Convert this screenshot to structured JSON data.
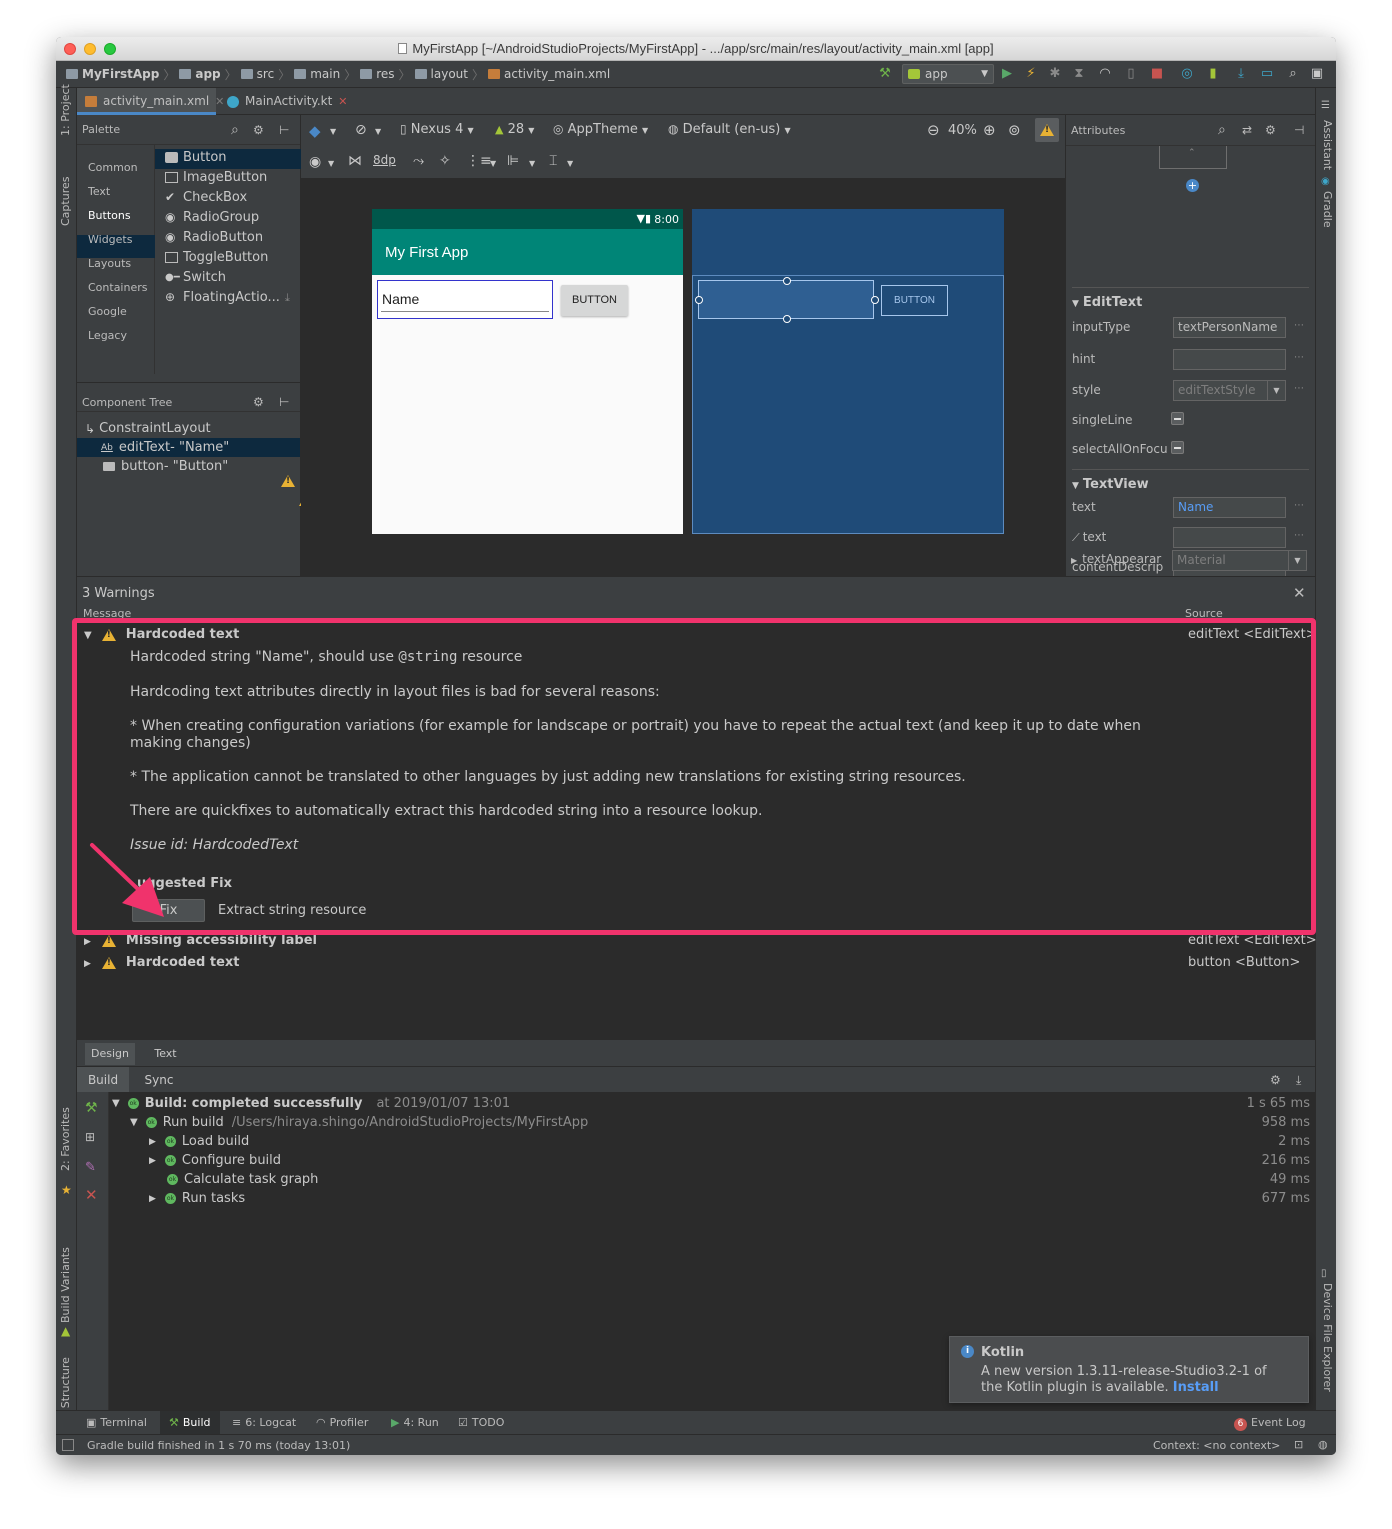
{
  "window": {
    "title": "MyFirstApp [~/AndroidStudioProjects/MyFirstApp] - .../app/src/main/res/layout/activity_main.xml [app]"
  },
  "breadcrumb": [
    "MyFirstApp",
    "app",
    "src",
    "main",
    "res",
    "layout",
    "activity_main.xml"
  ],
  "run_config": "app",
  "editor_tabs": [
    "activity_main.xml",
    "MainActivity.kt"
  ],
  "side_tools": {
    "left": [
      "1: Project",
      "Captures",
      "2: Favorites",
      "Build Variants",
      "Z: Structure"
    ],
    "right": [
      "Assistant",
      "Gradle",
      "Device File Explorer"
    ]
  },
  "palette": {
    "title": "Palette",
    "categories": [
      "Common",
      "Text",
      "Buttons",
      "Widgets",
      "Layouts",
      "Containers",
      "Google",
      "Legacy"
    ],
    "selected_category": "Buttons",
    "items": [
      "Button",
      "ImageButton",
      "CheckBox",
      "RadioGroup",
      "RadioButton",
      "ToggleButton",
      "Switch",
      "FloatingActio..."
    ]
  },
  "component_tree": {
    "title": "Component Tree",
    "root": "ConstraintLayout",
    "children": [
      {
        "prefix": "editText",
        "label": "- \"Name\""
      },
      {
        "prefix": "button",
        "label": "- \"Button\""
      }
    ]
  },
  "design_toolbar": {
    "device": "Nexus 4",
    "api": "28",
    "theme": "AppTheme",
    "locale": "Default (en-us)",
    "zoom": "40%",
    "margin": "8dp"
  },
  "phone": {
    "time": "8:00",
    "app_title": "My First App",
    "edit_text": "Name",
    "button": "BUTTON"
  },
  "attributes": {
    "title": "Attributes",
    "edittext_section": "EditText",
    "edittext_rows": [
      {
        "label": "inputType",
        "value": "textPersonName"
      },
      {
        "label": "hint",
        "value": ""
      },
      {
        "label": "style",
        "value": "editTextStyle"
      },
      {
        "label": "singleLine",
        "value": ""
      },
      {
        "label": "selectAllOnFocu",
        "value": ""
      }
    ],
    "textview_section": "TextView",
    "textview_rows": [
      {
        "label": "text",
        "value": "Name"
      },
      {
        "label": "text",
        "value": ""
      },
      {
        "label": "contentDescrip",
        "value": ""
      },
      {
        "label": "textAppearar",
        "value": "Material"
      }
    ]
  },
  "warnings": {
    "title": "3 Warnings",
    "col_message": "Message",
    "col_source": "Source",
    "expanded": {
      "title": "Hardcoded text",
      "source": "editText <EditText>",
      "summary_pre": "Hardcoded string \"Name\", should use ",
      "summary_code": "@string",
      "summary_post": " resource",
      "p1": "Hardcoding text attributes directly in layout files is bad for several reasons:",
      "p2": "* When creating configuration variations (for example for landscape or portrait) you have to repeat the actual text (and keep it up to date when making changes)",
      "p3": "* The application cannot be translated to other languages by just adding new translations for existing string resources.",
      "p4": "There are quickfixes to automatically extract this hardcoded string into a resource lookup.",
      "issue_id": "Issue id: HardcodedText",
      "suggested": "uggested Fix",
      "fix_button": "Fix",
      "fix_label": "Extract string resource"
    },
    "collapsed": [
      {
        "title": "Missing accessibility label",
        "source": "editText <EditText>"
      },
      {
        "title": "Hardcoded text",
        "source": "button <Button>"
      }
    ]
  },
  "design_tabs": [
    "Design",
    "Text"
  ],
  "build_tabs": [
    "Build",
    "Sync"
  ],
  "build": [
    {
      "label": "Build: completed successfully",
      "extra": "at 2019/01/07 13:01",
      "time": "1 s 65 ms"
    },
    {
      "label": "Run build",
      "extra": "/Users/hiraya.shingo/AndroidStudioProjects/MyFirstApp",
      "time": "958 ms"
    },
    {
      "label": "Load build",
      "extra": "",
      "time": "2 ms"
    },
    {
      "label": "Configure build",
      "extra": "",
      "time": "216 ms"
    },
    {
      "label": "Calculate task graph",
      "extra": "",
      "time": "49 ms"
    },
    {
      "label": "Run tasks",
      "extra": "",
      "time": "677 ms"
    }
  ],
  "notification": {
    "title": "Kotlin",
    "line1": "A new version 1.3.11-release-Studio3.2-1 of",
    "line2": "the Kotlin plugin is available.",
    "link": "Install"
  },
  "bottom_tools": [
    "Terminal",
    "Build",
    "6: Logcat",
    "Profiler",
    "4: Run",
    "TODO"
  ],
  "event_log": {
    "count": "6",
    "label": "Event Log"
  },
  "status": {
    "message": "Gradle build finished in 1 s 70 ms (today 13:01)",
    "context": "Context: <no context>"
  },
  "colors": {
    "highlight": "#f0336c",
    "app_bar": "#008577",
    "status_bar": "#00574b",
    "link": "#589df6",
    "warning": "#e8b234",
    "blueprint": "#1f4b78"
  }
}
